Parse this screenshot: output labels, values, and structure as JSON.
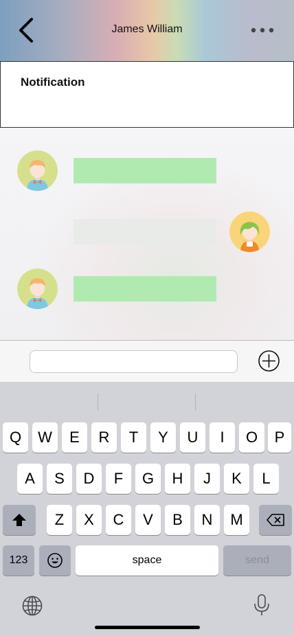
{
  "header": {
    "title": "James William",
    "back_icon": "chevron-left-icon",
    "more_icon": "more-horizontal-icon"
  },
  "notification": {
    "title": "Notification"
  },
  "messages": [
    {
      "sender": "other",
      "bubble_color": "#b1eab1",
      "avatar": "boy-avatar"
    },
    {
      "sender": "self",
      "bubble_color": "#e8ebe8",
      "avatar": "girl-avatar"
    },
    {
      "sender": "other",
      "bubble_color": "#b1eab1",
      "avatar": "boy-avatar"
    }
  ],
  "composer": {
    "placeholder": "",
    "attach_icon": "plus-circle-icon"
  },
  "keyboard": {
    "row1": [
      "Q",
      "W",
      "E",
      "R",
      "T",
      "Y",
      "U",
      "I",
      "O",
      "P"
    ],
    "row2": [
      "A",
      "S",
      "D",
      "F",
      "G",
      "H",
      "J",
      "K",
      "L"
    ],
    "row3": [
      "Z",
      "X",
      "C",
      "V",
      "B",
      "N",
      "M"
    ],
    "numbers_label": "123",
    "space_label": "space",
    "send_label": "send",
    "shift_icon": "shift-icon",
    "backspace_icon": "backspace-icon",
    "emoji_icon": "emoji-icon",
    "globe_icon": "globe-icon",
    "mic_icon": "microphone-icon"
  }
}
